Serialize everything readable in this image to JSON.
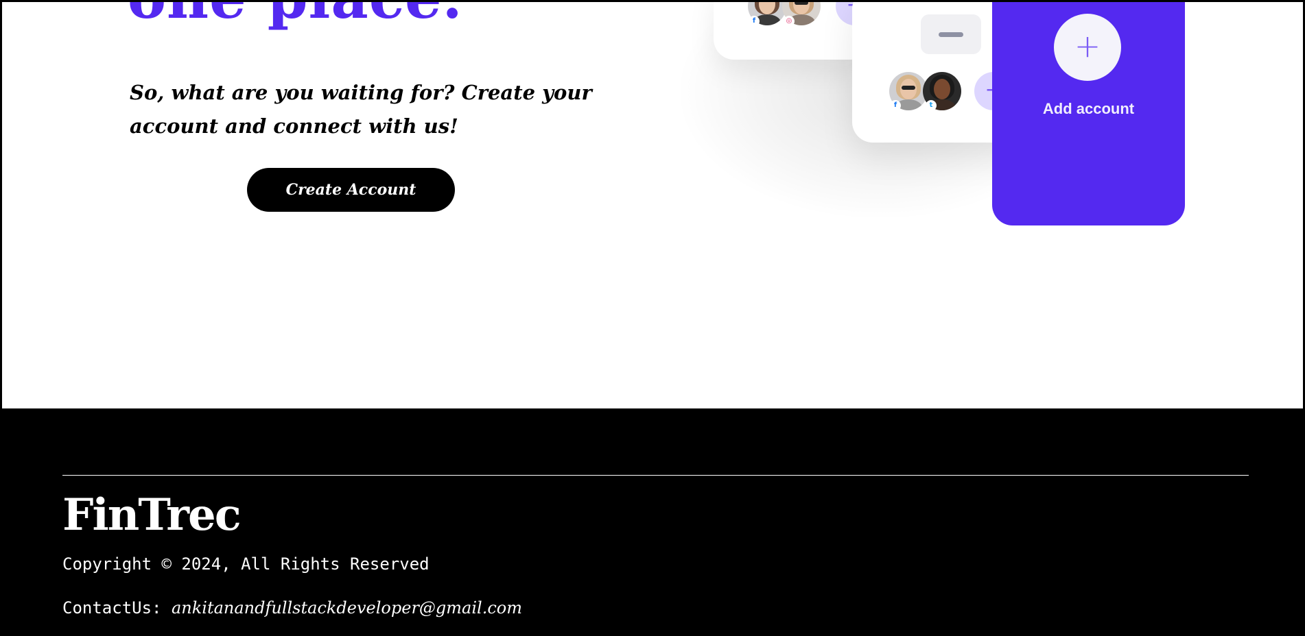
{
  "hero": {
    "title": "one place.",
    "subtitle": "So, what are you waiting for? Create your account and connect with us!",
    "cta_label": "Create Account"
  },
  "illustration": {
    "add_account_label": "Add account",
    "add_symbol": "+",
    "small_add_symbol": "+",
    "social_badges": [
      "facebook-icon",
      "instagram-icon",
      "facebook-icon",
      "twitter-icon"
    ]
  },
  "footer": {
    "brand": "FinTrec",
    "copyright": "Copyright © 2024, All Rights Reserved",
    "contact_label": "ContactUs:",
    "contact_email": "ankitanandfullstackdeveloper@gmail.com"
  },
  "colors": {
    "accent": "#5429f0",
    "footer_bg": "#000000",
    "button_bg": "#000000"
  }
}
